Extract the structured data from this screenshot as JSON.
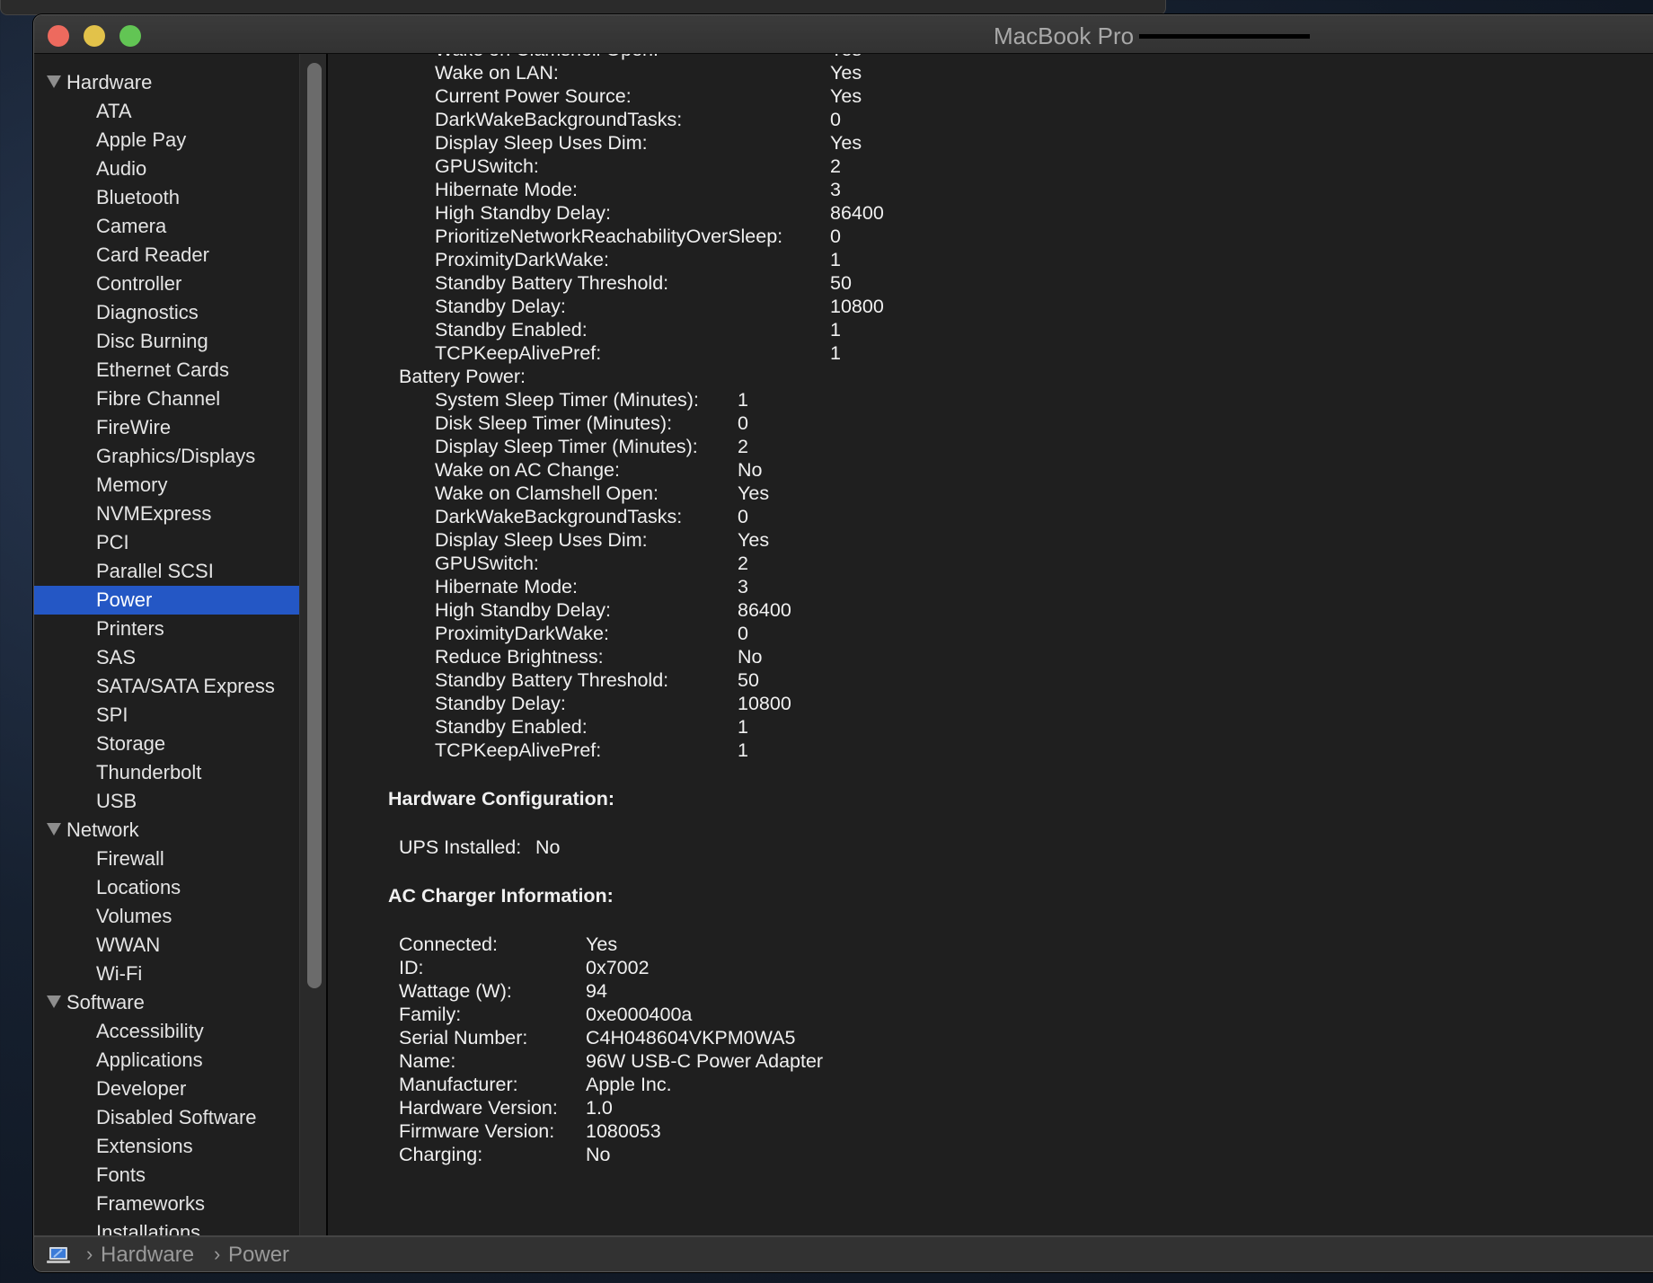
{
  "window": {
    "title": "MacBook Pro"
  },
  "sidebar": {
    "items": [
      {
        "label": "Hardware",
        "type": "group"
      },
      {
        "label": "ATA",
        "type": "child"
      },
      {
        "label": "Apple Pay",
        "type": "child"
      },
      {
        "label": "Audio",
        "type": "child"
      },
      {
        "label": "Bluetooth",
        "type": "child"
      },
      {
        "label": "Camera",
        "type": "child"
      },
      {
        "label": "Card Reader",
        "type": "child"
      },
      {
        "label": "Controller",
        "type": "child"
      },
      {
        "label": "Diagnostics",
        "type": "child"
      },
      {
        "label": "Disc Burning",
        "type": "child"
      },
      {
        "label": "Ethernet Cards",
        "type": "child"
      },
      {
        "label": "Fibre Channel",
        "type": "child"
      },
      {
        "label": "FireWire",
        "type": "child"
      },
      {
        "label": "Graphics/Displays",
        "type": "child"
      },
      {
        "label": "Memory",
        "type": "child"
      },
      {
        "label": "NVMExpress",
        "type": "child"
      },
      {
        "label": "PCI",
        "type": "child"
      },
      {
        "label": "Parallel SCSI",
        "type": "child"
      },
      {
        "label": "Power",
        "type": "child",
        "selected": true
      },
      {
        "label": "Printers",
        "type": "child"
      },
      {
        "label": "SAS",
        "type": "child"
      },
      {
        "label": "SATA/SATA Express",
        "type": "child"
      },
      {
        "label": "SPI",
        "type": "child"
      },
      {
        "label": "Storage",
        "type": "child"
      },
      {
        "label": "Thunderbolt",
        "type": "child"
      },
      {
        "label": "USB",
        "type": "child"
      },
      {
        "label": "Network",
        "type": "group"
      },
      {
        "label": "Firewall",
        "type": "child"
      },
      {
        "label": "Locations",
        "type": "child"
      },
      {
        "label": "Volumes",
        "type": "child"
      },
      {
        "label": "WWAN",
        "type": "child"
      },
      {
        "label": "Wi-Fi",
        "type": "child"
      },
      {
        "label": "Software",
        "type": "group"
      },
      {
        "label": "Accessibility",
        "type": "child"
      },
      {
        "label": "Applications",
        "type": "child"
      },
      {
        "label": "Developer",
        "type": "child"
      },
      {
        "label": "Disabled Software",
        "type": "child"
      },
      {
        "label": "Extensions",
        "type": "child"
      },
      {
        "label": "Fonts",
        "type": "child"
      },
      {
        "label": "Frameworks",
        "type": "child"
      },
      {
        "label": "Installations",
        "type": "child"
      }
    ]
  },
  "content": {
    "ac_power_partial": {
      "rows": [
        {
          "label": "Wake on Clamshell Open:",
          "value": "Yes"
        },
        {
          "label": "Wake on LAN:",
          "value": "Yes"
        },
        {
          "label": "Current Power Source:",
          "value": "Yes"
        },
        {
          "label": "DarkWakeBackgroundTasks:",
          "value": "0"
        },
        {
          "label": "Display Sleep Uses Dim:",
          "value": "Yes"
        },
        {
          "label": "GPUSwitch:",
          "value": "2"
        },
        {
          "label": "Hibernate Mode:",
          "value": "3"
        },
        {
          "label": "High Standby Delay:",
          "value": "86400"
        },
        {
          "label": "PrioritizeNetworkReachabilityOverSleep:",
          "value": "0"
        },
        {
          "label": "ProximityDarkWake:",
          "value": "1"
        },
        {
          "label": "Standby Battery Threshold:",
          "value": "50"
        },
        {
          "label": "Standby Delay:",
          "value": "10800"
        },
        {
          "label": "Standby Enabled:",
          "value": "1"
        },
        {
          "label": "TCPKeepAlivePref:",
          "value": "1"
        }
      ]
    },
    "battery_power": {
      "title": "Battery Power:",
      "rows": [
        {
          "label": "System Sleep Timer (Minutes):",
          "value": "1"
        },
        {
          "label": "Disk Sleep Timer (Minutes):",
          "value": "0"
        },
        {
          "label": "Display Sleep Timer (Minutes):",
          "value": "2"
        },
        {
          "label": "Wake on AC Change:",
          "value": "No"
        },
        {
          "label": "Wake on Clamshell Open:",
          "value": "Yes"
        },
        {
          "label": "DarkWakeBackgroundTasks:",
          "value": "0"
        },
        {
          "label": "Display Sleep Uses Dim:",
          "value": "Yes"
        },
        {
          "label": "GPUSwitch:",
          "value": "2"
        },
        {
          "label": "Hibernate Mode:",
          "value": "3"
        },
        {
          "label": "High Standby Delay:",
          "value": "86400"
        },
        {
          "label": "ProximityDarkWake:",
          "value": "0"
        },
        {
          "label": "Reduce Brightness:",
          "value": "No"
        },
        {
          "label": "Standby Battery Threshold:",
          "value": "50"
        },
        {
          "label": "Standby Delay:",
          "value": "10800"
        },
        {
          "label": "Standby Enabled:",
          "value": "1"
        },
        {
          "label": "TCPKeepAlivePref:",
          "value": "1"
        }
      ]
    },
    "hardware_configuration": {
      "title": "Hardware Configuration:",
      "rows": [
        {
          "label": "UPS Installed:",
          "value": "No"
        }
      ]
    },
    "ac_charger": {
      "title": "AC Charger Information:",
      "rows": [
        {
          "label": "Connected:",
          "value": "Yes"
        },
        {
          "label": "ID:",
          "value": "0x7002"
        },
        {
          "label": "Wattage (W):",
          "value": "94"
        },
        {
          "label": "Family:",
          "value": "0xe000400a"
        },
        {
          "label": "Serial Number:",
          "value": "C4H048604VKPM0WA5"
        },
        {
          "label": "Name:",
          "value": "96W USB-C Power Adapter"
        },
        {
          "label": "Manufacturer:",
          "value": "Apple Inc."
        },
        {
          "label": "Hardware Version:",
          "value": "1.0"
        },
        {
          "label": "Firmware Version:",
          "value": "1080053"
        },
        {
          "label": "Charging:",
          "value": "No"
        }
      ]
    }
  },
  "statusbar": {
    "icon": "laptop-icon",
    "breadcrumb": [
      "Hardware",
      "Power"
    ]
  },
  "colors": {
    "selection": "#2457c5",
    "close": "#ed6a5e",
    "minimize": "#e2c24a",
    "zoom": "#62c554"
  }
}
